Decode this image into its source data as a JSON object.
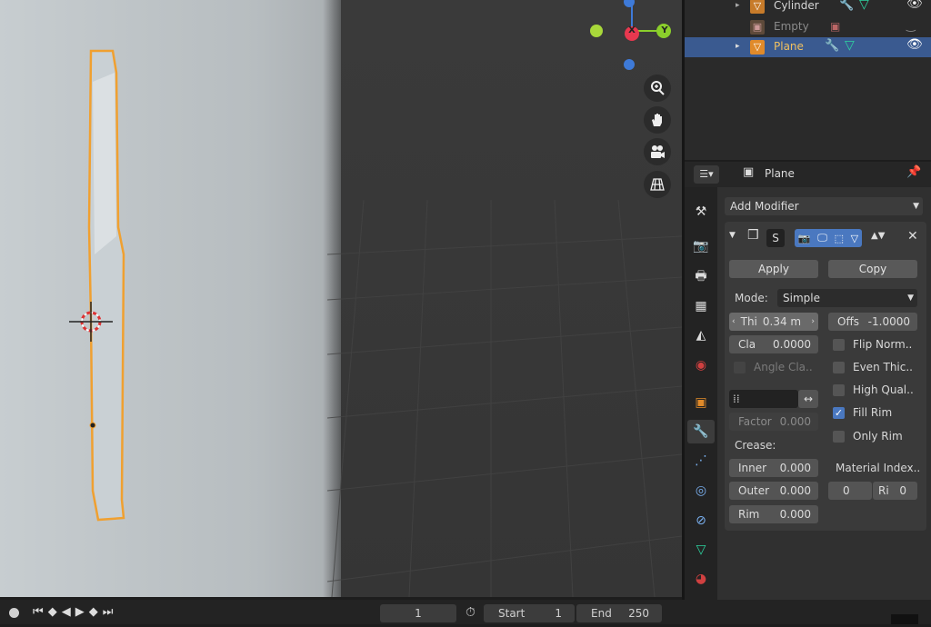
{
  "outliner": {
    "items": [
      {
        "label": "Cylinder"
      },
      {
        "label": "Empty"
      },
      {
        "label": "Plane"
      }
    ]
  },
  "viewport": {
    "gizmo": {
      "x": "X",
      "y": "Y"
    }
  },
  "properties": {
    "object_name": "Plane",
    "add_modifier": "Add Modifier",
    "modifier_name": "S",
    "apply": "Apply",
    "copy": "Copy",
    "mode_label": "Mode:",
    "mode_value": "Simple",
    "thickness_label": "Thi",
    "thickness_value": "0.34 m",
    "offset_label": "Offs",
    "offset_value": "-1.0000",
    "clamp_label": "Cla",
    "clamp_value": "0.0000",
    "angle_clamp": "Angle Cla..",
    "factor_label": "Factor",
    "factor_value": "0.000",
    "crease_label": "Crease:",
    "inner_label": "Inner",
    "inner_value": "0.000",
    "outer_label": "Outer",
    "outer_value": "0.000",
    "rim_label": "Rim",
    "rim_value": "0.000",
    "material_index_label": "Material Index..",
    "material_index_value": "0",
    "material_rim_label": "Ri",
    "material_rim_value": "0",
    "flip_normals": "Flip Norm..",
    "even_thickness": "Even Thic..",
    "high_quality": "High Qual..",
    "fill_rim": "Fill Rim",
    "only_rim": "Only Rim"
  },
  "checks": {
    "flip_normals": false,
    "even_thickness": false,
    "high_quality": false,
    "fill_rim": true,
    "only_rim": false
  },
  "timeline": {
    "current_frame": "1",
    "start_label": "Start",
    "start_value": "1",
    "end_label": "End",
    "end_value": "250"
  },
  "icons": {
    "zoom": "zoom-icon",
    "pan": "hand-icon",
    "camera": "camera-icon",
    "grid": "perspective-grid-icon",
    "wrench": "wrench-icon",
    "eye": "eye-icon",
    "pin": "pin-icon"
  },
  "colors": {
    "accent": "#4a78c0",
    "selection_orange": "#f0a030",
    "x_axis": "#e8384f",
    "y_axis": "#8bcf2b",
    "z_axis": "#3e7ad8"
  }
}
